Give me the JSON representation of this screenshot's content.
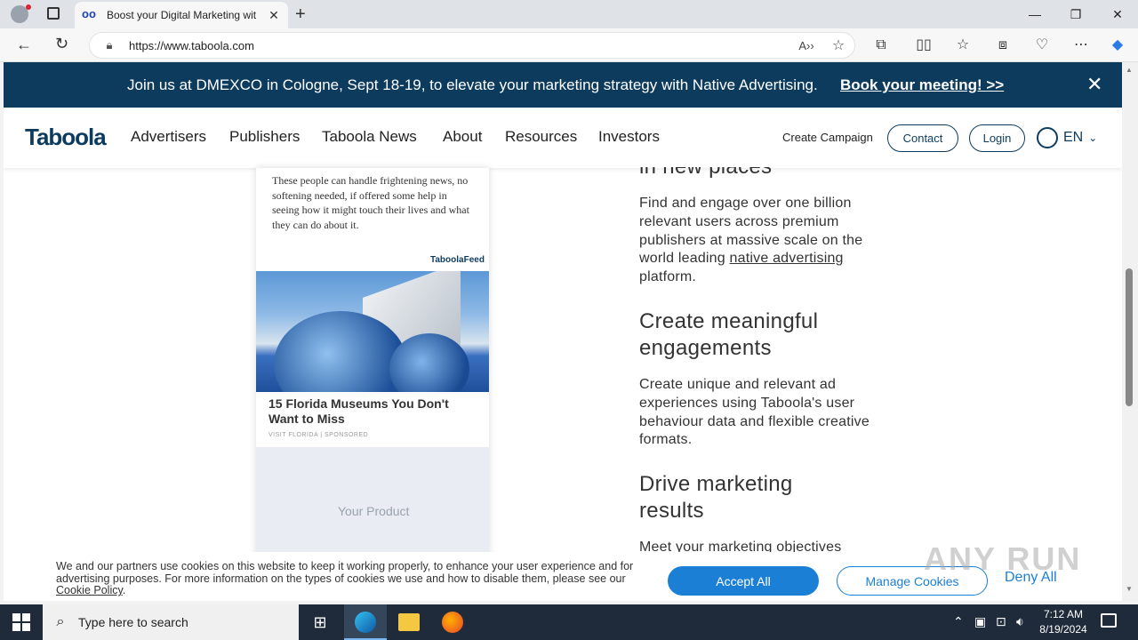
{
  "browser": {
    "tab_title": "Boost your Digital Marketing wit",
    "url": "https://www.taboola.com",
    "tab_favicon": "taboola-logo"
  },
  "banner": {
    "message": "Join us at DMEXCO in Cologne, Sept 18-19, to elevate your marketing strategy with Native Advertising.",
    "cta": "Book your meeting! >>",
    "close": "✕"
  },
  "nav": {
    "logo": "Taboola",
    "links": [
      "Advertisers",
      "Publishers",
      "Taboola News",
      "About",
      "Resources",
      "Investors"
    ],
    "create_campaign": "Create Campaign",
    "contact": "Contact",
    "login": "Login",
    "language": "EN"
  },
  "phone": {
    "quote": "These people can handle frightening news, no softening needed, if offered some help in seeing how it might touch their lives and what they can do about it.",
    "feed_label": "TaboolaFeed",
    "headline": "15 Florida Museums You Don't Want to Miss",
    "sponsor": "VISIT FLORIDA | SPONSORED",
    "product_placeholder": "Your Product"
  },
  "content": {
    "partial_heading": "in new places",
    "p1_before": "Find and engage over one billion relevant users across premium publishers at massive scale on the world leading ",
    "p1_link": "native advertising",
    "p1_after": " platform.",
    "h2": "Create meaningful engagements",
    "p2": "Create unique and relevant ad experiences using Taboola's user behaviour data and flexible creative formats.",
    "h3": "Drive marketing results",
    "p3": "Meet your marketing objectives"
  },
  "cookie": {
    "text": "We and our partners use cookies on this website to keep it working properly, to enhance your user experience and for advertising purposes. For more information on the types of cookies we use and how to disable them, please see our ",
    "policy_link": "Cookie Policy",
    "text_end": ".",
    "accept": "Accept All",
    "manage": "Manage Cookies",
    "deny": "Deny All"
  },
  "watermark": "ANY RUN",
  "taskbar": {
    "search_placeholder": "Type here to search",
    "time": "7:12 AM",
    "date": "8/19/2024"
  }
}
